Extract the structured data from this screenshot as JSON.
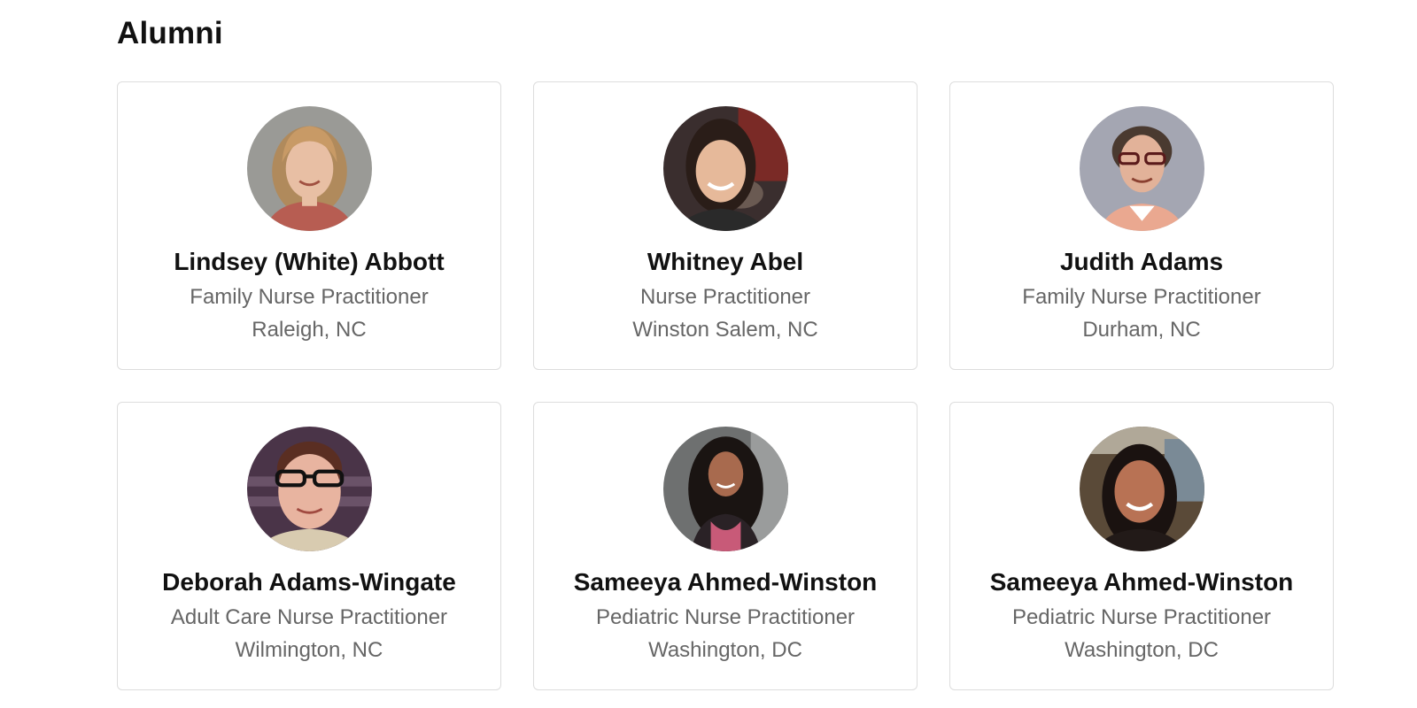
{
  "section": {
    "title": "Alumni"
  },
  "alumni": [
    {
      "name": "Lindsey (White) Abbott",
      "role": "Family Nurse Practitioner",
      "location": "Raleigh, NC"
    },
    {
      "name": "Whitney Abel",
      "role": "Nurse Practitioner",
      "location": "Winston Salem, NC"
    },
    {
      "name": "Judith Adams",
      "role": "Family Nurse Practitioner",
      "location": "Durham, NC"
    },
    {
      "name": "Deborah Adams-Wingate",
      "role": "Adult Care Nurse Practitioner",
      "location": "Wilmington, NC"
    },
    {
      "name": "Sameeya Ahmed-Winston",
      "role": "Pediatric Nurse Practitioner",
      "location": "Washington, DC"
    },
    {
      "name": "Sameeya Ahmed-Winston",
      "role": "Pediatric Nurse Practitioner",
      "location": "Washington, DC"
    }
  ],
  "colors": {
    "card_border": "#dddddd",
    "name_text": "#111111",
    "secondary_text": "#666666"
  }
}
